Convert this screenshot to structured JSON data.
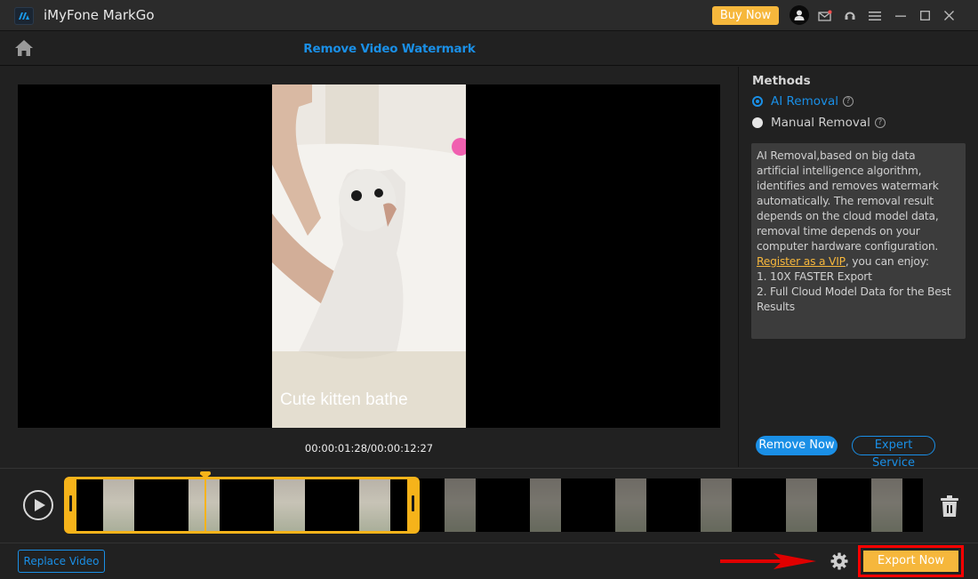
{
  "app": {
    "title": "iMyFone MarkGo",
    "buy_now_label": "Buy Now",
    "brand_color": "#1a8fe6",
    "accent_color": "#f6b73c"
  },
  "titlebar_icons": [
    "user-avatar-icon",
    "mail-icon",
    "support-headset-icon",
    "menu-icon",
    "minimize-icon",
    "maximize-icon",
    "close-icon"
  ],
  "header": {
    "home_icon": "home-icon",
    "page_title": "Remove Video Watermark"
  },
  "player": {
    "caption": "Cute kitten bathe",
    "current_time": "00:00:01:28",
    "total_time": "00:00:12:27",
    "timecode": "00:00:01:28/00:00:12:27"
  },
  "methods": {
    "label": "Methods",
    "options": [
      {
        "label": "AI Removal",
        "selected": true,
        "help_icon": "question-circle-icon"
      },
      {
        "label": "Manual Removal",
        "selected": false,
        "help_icon": "question-circle-icon"
      }
    ],
    "description": "AI Removal,based on big data artificial intelligence algorithm, identifies and removes watermark automatically. The removal result depends on the cloud model data, removal time depends on your computer hardware configuration.",
    "vip_link": "Register as a VIP",
    "vip_suffix": ", you can enjoy:",
    "benefits": [
      "1. 10X FASTER Export",
      "2. Full Cloud Model Data for the Best Results"
    ],
    "remove_now_label": "Remove Now",
    "expert_service_label": "Expert Service"
  },
  "timeline": {
    "play_icon": "play-circle-icon",
    "delete_icon": "trash-icon",
    "selection_start_fraction": 0.0,
    "selection_end_fraction": 0.38,
    "playhead_fraction": 0.15
  },
  "footer": {
    "replace_video_label": "Replace Video",
    "settings_icon": "gear-icon",
    "export_now_label": "Export Now",
    "highlight_color": "#ff0000"
  }
}
